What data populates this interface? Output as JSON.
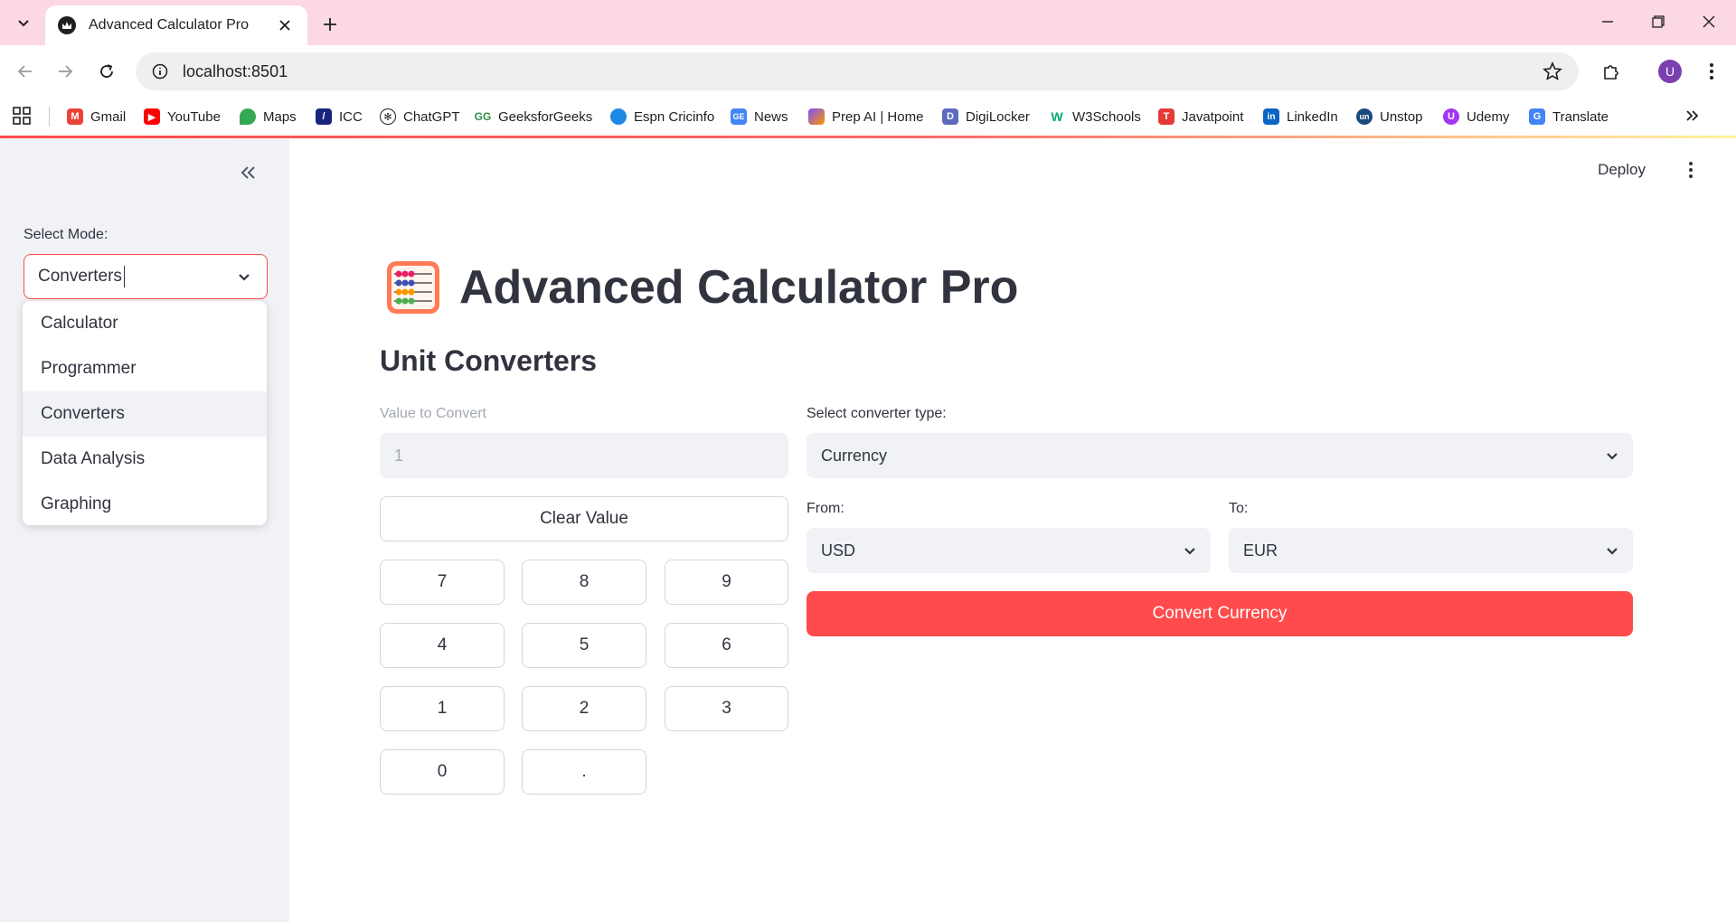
{
  "browser": {
    "tab_title": "Advanced Calculator Pro",
    "url": "localhost:8501",
    "profile_initial": "U",
    "bookmarks": [
      {
        "label": "Gmail",
        "icon": "gmail-icon",
        "color": "#ea4335"
      },
      {
        "label": "YouTube",
        "icon": "youtube-icon",
        "color": "#ff0000"
      },
      {
        "label": "Maps",
        "icon": "maps-icon",
        "color": "#34a853"
      },
      {
        "label": "ICC",
        "icon": "icc-icon",
        "color": "#1a237e"
      },
      {
        "label": "ChatGPT",
        "icon": "chatgpt-icon",
        "color": "#1f1f1f"
      },
      {
        "label": "GeeksforGeeks",
        "icon": "geeksforgeeks-icon",
        "color": "#2f8d46"
      },
      {
        "label": "Espn Cricinfo",
        "icon": "espn-cricinfo-icon",
        "color": "#1e88e5"
      },
      {
        "label": "News",
        "icon": "news-icon",
        "color": "#4285f4"
      },
      {
        "label": "Prep AI | Home",
        "icon": "prep-ai-icon",
        "color": "#7c4dff"
      },
      {
        "label": "DigiLocker",
        "icon": "digilocker-icon",
        "color": "#5c6bc0"
      },
      {
        "label": "W3Schools",
        "icon": "w3schools-icon",
        "color": "#04aa6d"
      },
      {
        "label": "Javatpoint",
        "icon": "javatpoint-icon",
        "color": "#e53935"
      },
      {
        "label": "LinkedIn",
        "icon": "linkedin-icon",
        "color": "#0a66c2"
      },
      {
        "label": "Unstop",
        "icon": "unstop-icon",
        "color": "#1c4980"
      },
      {
        "label": "Udemy",
        "icon": "udemy-icon",
        "color": "#a435f0"
      },
      {
        "label": "Translate",
        "icon": "translate-icon",
        "color": "#4285f4"
      }
    ]
  },
  "sidebar": {
    "mode_label": "Select Mode:",
    "mode_value": "Converters",
    "options": [
      "Calculator",
      "Programmer",
      "Converters",
      "Data Analysis",
      "Graphing"
    ],
    "active_option": "Converters"
  },
  "header": {
    "deploy_label": "Deploy"
  },
  "main": {
    "app_title": "Advanced Calculator Pro",
    "section_title": "Unit Converters",
    "value_label": "Value to Convert",
    "value_input": "1",
    "clear_label": "Clear Value",
    "keypad": [
      "7",
      "8",
      "9",
      "4",
      "5",
      "6",
      "1",
      "2",
      "3",
      "0",
      "."
    ],
    "converter_type_label": "Select converter type:",
    "converter_type_value": "Currency",
    "from_label": "From:",
    "from_value": "USD",
    "to_label": "To:",
    "to_value": "EUR",
    "convert_label": "Convert Currency"
  },
  "colors": {
    "accent": "#ff4b4b",
    "sidebar_bg": "#f0f2f6",
    "tabstrip_bg": "#fbd8e3"
  }
}
